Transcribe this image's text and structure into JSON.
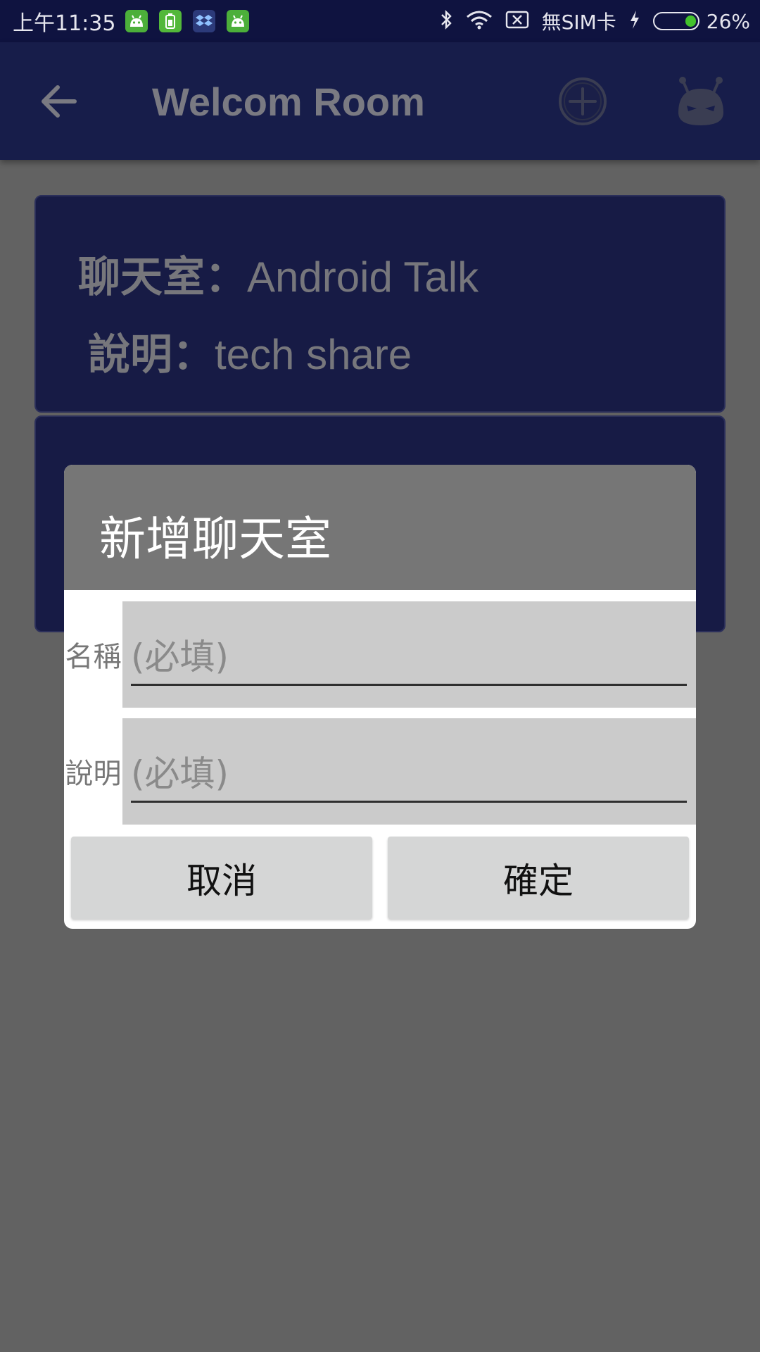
{
  "status_bar": {
    "time": "上午11:35",
    "carrier": "無SIM卡",
    "battery_percent": "26%",
    "battery_level": 0.26,
    "notification_icons": [
      "android-icon",
      "battery-app-icon",
      "dropbox-icon",
      "android-icon"
    ],
    "status_icons": [
      "bluetooth-icon",
      "wifi-icon",
      "no-sim-icon",
      "charging-icon"
    ]
  },
  "app_bar": {
    "title": "Welcom Room",
    "back_icon": "arrow-left-icon",
    "add_icon": "add-circle-icon",
    "bot_icon": "bot-face-icon"
  },
  "rooms": [
    {
      "name_label": "聊天室：",
      "name": "Android Talk",
      "desc_label": "說明：",
      "desc": "tech share"
    }
  ],
  "dialog": {
    "title": "新增聊天室",
    "fields": [
      {
        "label": "名稱",
        "placeholder": "(必填)",
        "value": ""
      },
      {
        "label": "說明",
        "placeholder": "(必填)",
        "value": ""
      }
    ],
    "cancel_label": "取消",
    "ok_label": "確定"
  },
  "colors": {
    "status_bar_bg": "#0f1340",
    "app_bar_bg": "#171d4a",
    "card_bg": "#171b45",
    "scrim": "#626262",
    "dialog_header": "#767676",
    "field_bg": "#cbcbcb",
    "button_bg": "#d5d6d6",
    "battery_fill": "#43c22d"
  }
}
